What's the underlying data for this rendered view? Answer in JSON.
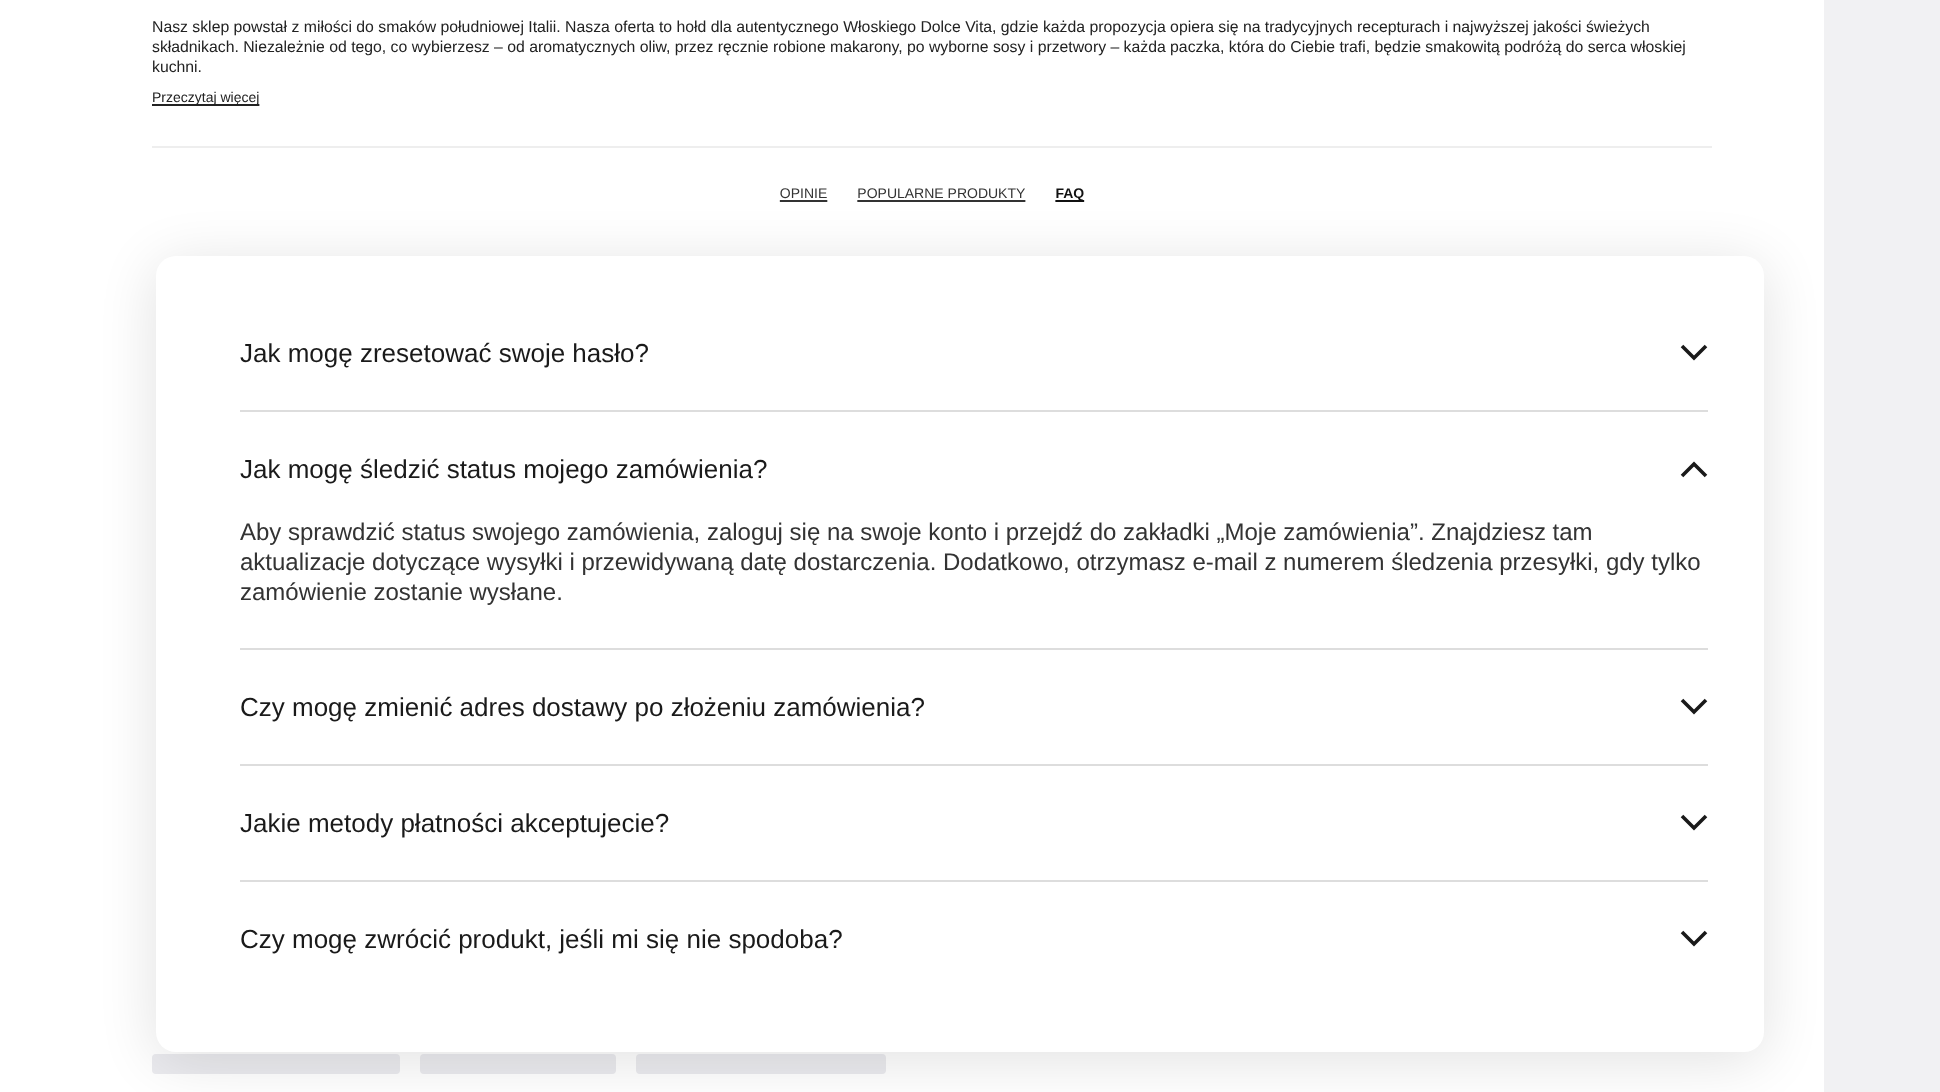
{
  "about": {
    "text": "Nasz sklep powstał z miłości do smaków południowej Italii. Nasza oferta to hołd dla autentycznego Włoskiego Dolce Vita, gdzie każda propozycja opiera się na tradycyjnych recepturach i najwyższej jakości świeżych składnikach. Niezależnie od tego, co wybierzesz – od aromatycznych oliw, przez ręcznie robione makarony, po wyborne sosy i przetwory – każda paczka, która do Ciebie trafi, będzie smakowitą podróżą do serca włoskiej kuchni.",
    "link": "Przeczytaj więcej"
  },
  "nav": [
    {
      "label": "OPINIE",
      "selected": false
    },
    {
      "label": "POPULARNE PRODUKTY",
      "selected": false
    },
    {
      "label": "FAQ",
      "selected": true
    }
  ],
  "faq": [
    {
      "question": "Jak mogę zresetować swoje hasło?",
      "expanded": false
    },
    {
      "question": "Jak mogę śledzić status mojego zamówienia?",
      "expanded": true,
      "answer": "Aby sprawdzić status swojego zamówienia, zaloguj się na swoje konto i przejdź do zakładki „Moje zamówienia”. Znajdziesz tam aktualizacje dotyczące wysyłki i przewidywaną datę dostarczenia. Dodatkowo, otrzymasz e-mail z numerem śledzenia przesyłki, gdy tylko zamówienie zostanie wysłane."
    },
    {
      "question": "Czy mogę zmienić adres dostawy po złożeniu zamówienia?",
      "expanded": false
    },
    {
      "question": "Jakie metody płatności akceptujecie?",
      "expanded": false
    },
    {
      "question": "Czy mogę zwrócić produkt, jeśli mi się nie spodoba?",
      "expanded": false
    }
  ]
}
